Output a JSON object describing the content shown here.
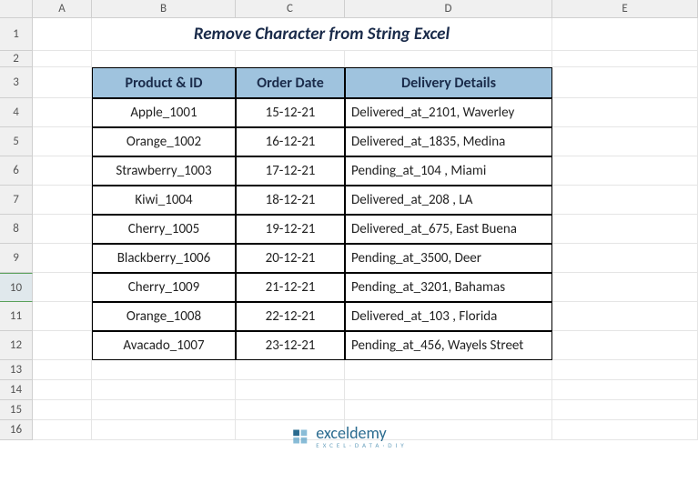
{
  "cols": [
    "A",
    "B",
    "C",
    "D",
    "E"
  ],
  "rows": [
    "1",
    "2",
    "3",
    "4",
    "5",
    "6",
    "7",
    "8",
    "9",
    "10",
    "11",
    "12",
    "13",
    "14",
    "15",
    "16"
  ],
  "selected_row": "10",
  "title": "Remove Character from String Excel",
  "headers": {
    "product": "Product & ID",
    "order": "Order Date",
    "delivery": "Delivery Details"
  },
  "data": [
    {
      "product": "Apple_1001",
      "order": "15-12-21",
      "delivery": "Delivered_at_2101, Waverley"
    },
    {
      "product": "Orange_1002",
      "order": "16-12-21",
      "delivery": "Delivered_at_1835, Medina"
    },
    {
      "product": "Strawberry_1003",
      "order": "17-12-21",
      "delivery": "Pending_at_104 , Miami"
    },
    {
      "product": "Kiwi_1004",
      "order": "18-12-21",
      "delivery": "Delivered_at_208 , LA"
    },
    {
      "product": "Cherry_1005",
      "order": "19-12-21",
      "delivery": "Delivered_at_675, East Buena"
    },
    {
      "product": "Blackberry_1006",
      "order": "20-12-21",
      "delivery": "Pending_at_3500, Deer"
    },
    {
      "product": "Cherry_1009",
      "order": "21-12-21",
      "delivery": "Pending_at_3201, Bahamas"
    },
    {
      "product": "Orange_1008",
      "order": "22-12-21",
      "delivery": "Delivered_at_103 , Florida"
    },
    {
      "product": "Avacado_1007",
      "order": "23-12-21",
      "delivery": "Pending_at_456, Wayels Street"
    }
  ],
  "brand": {
    "name": "exceldemy",
    "tagline": "EXCEL·DATA·DIY"
  }
}
